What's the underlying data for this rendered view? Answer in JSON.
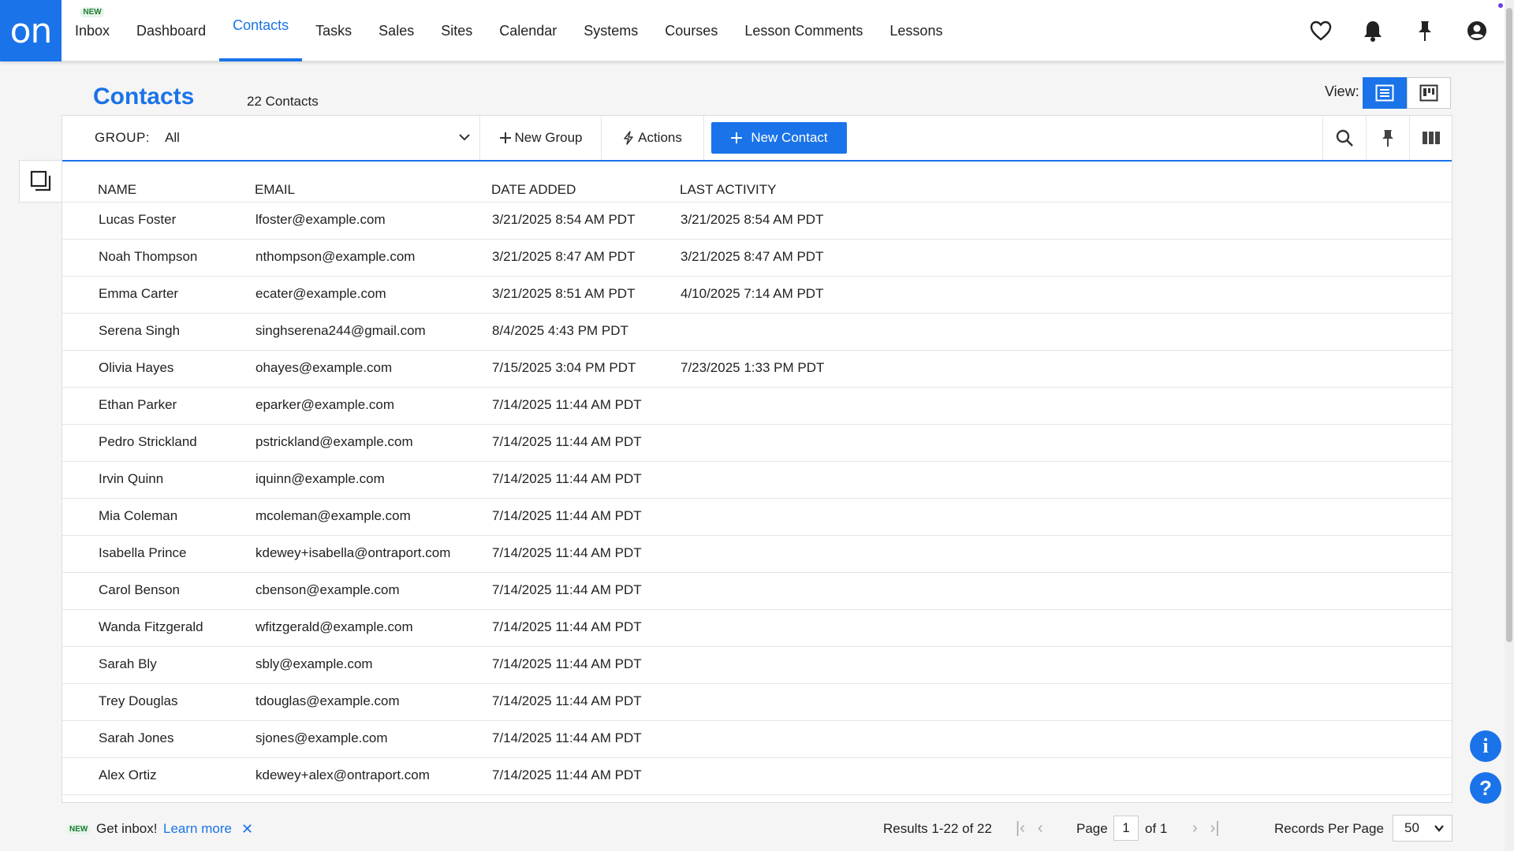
{
  "app": {
    "logo_text": "on"
  },
  "nav": {
    "items": [
      {
        "label": "Inbox",
        "badge": "NEW"
      },
      {
        "label": "Dashboard"
      },
      {
        "label": "Contacts"
      },
      {
        "label": "Tasks"
      },
      {
        "label": "Sales"
      },
      {
        "label": "Sites"
      },
      {
        "label": "Calendar"
      },
      {
        "label": "Systems"
      },
      {
        "label": "Courses"
      },
      {
        "label": "Lesson Comments"
      },
      {
        "label": "Lessons"
      }
    ],
    "active": "Contacts",
    "icons": [
      "heart-icon",
      "bell-icon",
      "pin-icon",
      "user-account-icon"
    ]
  },
  "page": {
    "title": "Contacts",
    "count": "22 Contacts",
    "view_label": "View:"
  },
  "toolbar": {
    "group_label": "GROUP:",
    "group_value": "All",
    "new_group_label": "New Group",
    "actions_label": "Actions",
    "new_contact_label": "New Contact"
  },
  "table": {
    "headers": {
      "name": "NAME",
      "email": "EMAIL",
      "date_added": "DATE ADDED",
      "last_activity": "LAST ACTIVITY"
    },
    "rows": [
      {
        "name": "Lucas Foster",
        "email": "lfoster@example.com",
        "date_added": "3/21/2025 8:54 AM PDT",
        "last_activity": "3/21/2025 8:54 AM PDT"
      },
      {
        "name": "Noah Thompson",
        "email": "nthompson@example.com",
        "date_added": "3/21/2025 8:47 AM PDT",
        "last_activity": "3/21/2025 8:47 AM PDT"
      },
      {
        "name": "Emma Carter",
        "email": "ecater@example.com",
        "date_added": "3/21/2025 8:51 AM PDT",
        "last_activity": "4/10/2025 7:14 AM PDT"
      },
      {
        "name": "Serena Singh",
        "email": "singhserena244@gmail.com",
        "date_added": "8/4/2025 4:43 PM PDT",
        "last_activity": ""
      },
      {
        "name": "Olivia Hayes",
        "email": "ohayes@example.com",
        "date_added": "7/15/2025 3:04 PM PDT",
        "last_activity": "7/23/2025 1:33 PM PDT"
      },
      {
        "name": "Ethan Parker",
        "email": "eparker@example.com",
        "date_added": "7/14/2025 11:44 AM PDT",
        "last_activity": ""
      },
      {
        "name": "Pedro Strickland",
        "email": "pstrickland@example.com",
        "date_added": "7/14/2025 11:44 AM PDT",
        "last_activity": ""
      },
      {
        "name": "Irvin Quinn",
        "email": "iquinn@example.com",
        "date_added": "7/14/2025 11:44 AM PDT",
        "last_activity": ""
      },
      {
        "name": "Mia Coleman",
        "email": "mcoleman@example.com",
        "date_added": "7/14/2025 11:44 AM PDT",
        "last_activity": ""
      },
      {
        "name": "Isabella Prince",
        "email": "kdewey+isabella@ontraport.com",
        "date_added": "7/14/2025 11:44 AM PDT",
        "last_activity": ""
      },
      {
        "name": "Carol Benson",
        "email": "cbenson@example.com",
        "date_added": "7/14/2025 11:44 AM PDT",
        "last_activity": ""
      },
      {
        "name": "Wanda Fitzgerald",
        "email": "wfitzgerald@example.com",
        "date_added": "7/14/2025 11:44 AM PDT",
        "last_activity": ""
      },
      {
        "name": "Sarah Bly",
        "email": "sbly@example.com",
        "date_added": "7/14/2025 11:44 AM PDT",
        "last_activity": ""
      },
      {
        "name": "Trey Douglas",
        "email": "tdouglas@example.com",
        "date_added": "7/14/2025 11:44 AM PDT",
        "last_activity": ""
      },
      {
        "name": "Sarah Jones",
        "email": "sjones@example.com",
        "date_added": "7/14/2025 11:44 AM PDT",
        "last_activity": ""
      },
      {
        "name": "Alex Ortiz",
        "email": "kdewey+alex@ontraport.com",
        "date_added": "7/14/2025 11:44 AM PDT",
        "last_activity": ""
      }
    ]
  },
  "footer": {
    "new_badge": "NEW",
    "inbox_msg": "Get inbox!",
    "learn_more": "Learn more",
    "results": "Results 1-22  of  22",
    "page_label": "Page",
    "page_value": "1",
    "of_label": "of  1",
    "rpp_label": "Records Per Page",
    "rpp_value": "50"
  },
  "colors": {
    "accent": "#1a73e8",
    "badge_green": "#1e7d32"
  }
}
